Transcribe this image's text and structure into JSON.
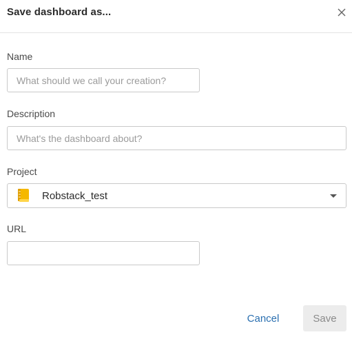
{
  "dialog": {
    "title": "Save dashboard as...",
    "close_icon": "close-icon"
  },
  "form": {
    "name": {
      "label": "Name",
      "placeholder": "What should we call your creation?",
      "value": ""
    },
    "description": {
      "label": "Description",
      "placeholder": "What's the dashboard about?",
      "value": ""
    },
    "project": {
      "label": "Project",
      "selected": "Robstack_test",
      "icon": "notebook-icon",
      "icon_color": "#f5b800"
    },
    "url": {
      "label": "URL",
      "placeholder": "",
      "value": ""
    }
  },
  "footer": {
    "cancel_label": "Cancel",
    "save_label": "Save",
    "link_color": "#2a6fb0"
  }
}
